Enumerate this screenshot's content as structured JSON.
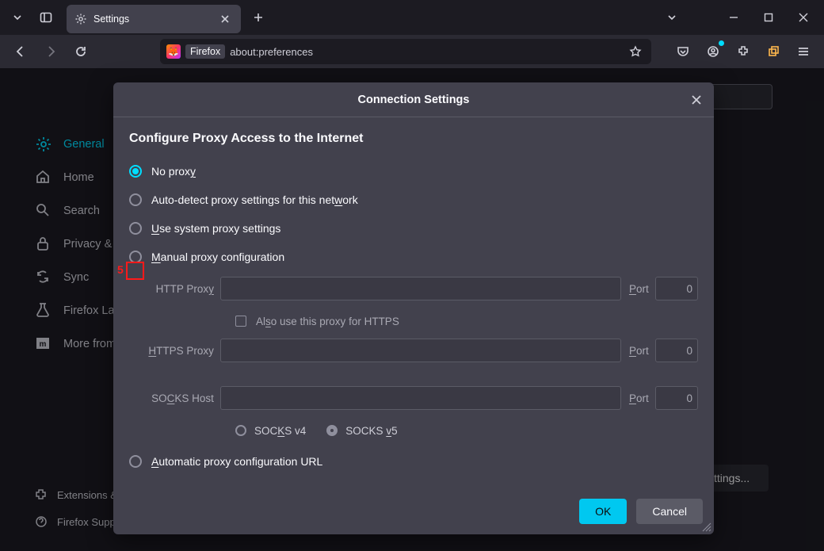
{
  "tab": {
    "label": "Settings"
  },
  "urlbar": {
    "brand": "Firefox",
    "url": "about:preferences"
  },
  "sidebar": {
    "items": [
      {
        "label": "General"
      },
      {
        "label": "Home"
      },
      {
        "label": "Search"
      },
      {
        "label": "Privacy & Security"
      },
      {
        "label": "Sync"
      },
      {
        "label": "Firefox Labs"
      },
      {
        "label": "More from Mozilla"
      }
    ],
    "footer": [
      {
        "label": "Extensions & Themes"
      },
      {
        "label": "Firefox Support"
      }
    ]
  },
  "page": {
    "settings_button": "Settings..."
  },
  "dialog": {
    "title": "Connection Settings",
    "heading": "Configure Proxy Access to the Internet",
    "opts": {
      "no_proxy": "No prox",
      "no_proxy_u": "y",
      "auto_a": "Auto-detect proxy settings for this net",
      "auto_u": "w",
      "auto_b": "ork",
      "sys_u": "U",
      "sys_b": "se system proxy settings",
      "manual_u": "M",
      "manual_b": "anual proxy configuration",
      "autourl_u": "A",
      "autourl_b": "utomatic proxy configuration URL"
    },
    "proxy": {
      "http_label_a": "HTTP Prox",
      "http_label_u": "y",
      "https_label_u": "H",
      "https_label_b": "TTPS Proxy",
      "socks_label_a": "SO",
      "socks_label_u": "C",
      "socks_label_b": "KS Host",
      "port_label_u": "P",
      "port_label_b": "ort",
      "port_value": "0",
      "also_a": "Al",
      "also_u": "s",
      "also_b": "o use this proxy for HTTPS",
      "v4_a": "SOC",
      "v4_u": "K",
      "v4_b": "S v4",
      "v5_a": "SOCKS ",
      "v5_u": "v",
      "v5_b": "5"
    },
    "buttons": {
      "ok": "OK",
      "cancel": "Cancel"
    }
  },
  "annotation": {
    "num": "5"
  }
}
